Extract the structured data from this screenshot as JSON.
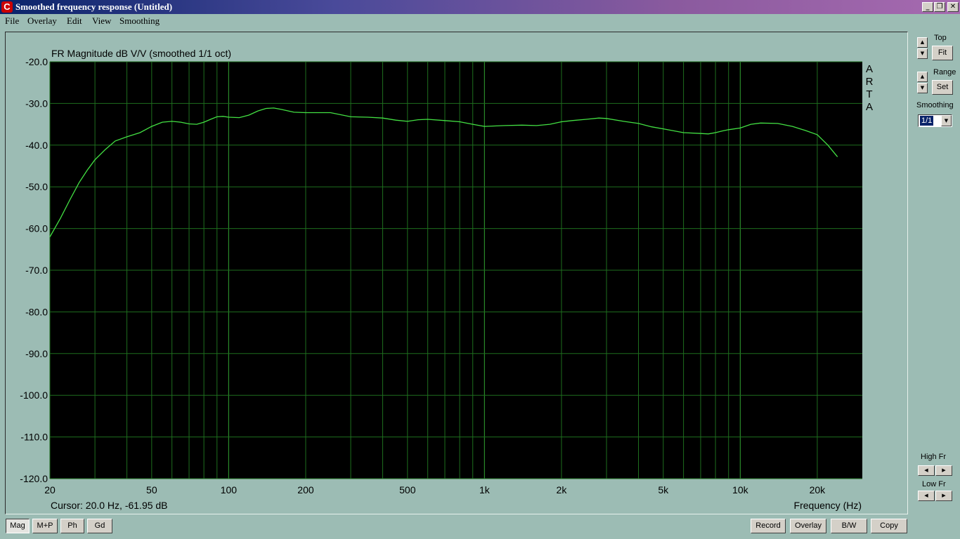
{
  "window": {
    "title": "Smoothed frequency response (Untitled)",
    "app_icon": "arta-c-icon",
    "controls": [
      "minimize-icon",
      "restore-icon",
      "close-icon"
    ]
  },
  "menu": [
    "File",
    "Overlay",
    "Edit",
    "View",
    "Smoothing"
  ],
  "plot": {
    "watermark": "A R T A",
    "cursor_readout": "Cursor: 20.0 Hz, -61.95 dB",
    "background": "#000000",
    "grid_color": "#1e6e1e",
    "trace_color": "#43e043"
  },
  "side_panel": {
    "top_label": "Top",
    "fit_button": "Fit",
    "range_label": "Range",
    "set_button": "Set",
    "smoothing_label": "Smoothing",
    "smoothing_value": "1/1",
    "high_fr_label": "High Fr",
    "low_fr_label": "Low Fr"
  },
  "bottom_left_buttons": [
    "Mag",
    "M+P",
    "Ph",
    "Gd"
  ],
  "active_tab": "Mag",
  "bottom_right_buttons": [
    "Record",
    "Overlay",
    "B/W",
    "Copy"
  ],
  "chart_data": {
    "type": "line",
    "title": "FR Magnitude dB V/V (smoothed 1/1 oct)",
    "xlabel": "Frequency (Hz)",
    "ylabel": "",
    "x_scale": "log",
    "xlim": [
      20,
      30000
    ],
    "ylim": [
      -120,
      -20
    ],
    "grid": true,
    "x_ticks": [
      {
        "value": 20,
        "label": "20"
      },
      {
        "value": 50,
        "label": "50"
      },
      {
        "value": 100,
        "label": "100"
      },
      {
        "value": 200,
        "label": "200"
      },
      {
        "value": 500,
        "label": "500"
      },
      {
        "value": 1000,
        "label": "1k"
      },
      {
        "value": 2000,
        "label": "2k"
      },
      {
        "value": 5000,
        "label": "5k"
      },
      {
        "value": 10000,
        "label": "10k"
      },
      {
        "value": 20000,
        "label": "20k"
      }
    ],
    "y_ticks": [
      {
        "value": -20,
        "label": "-20.0"
      },
      {
        "value": -30,
        "label": "-30.0"
      },
      {
        "value": -40,
        "label": "-40.0"
      },
      {
        "value": -50,
        "label": "-50.0"
      },
      {
        "value": -60,
        "label": "-60.0"
      },
      {
        "value": -70,
        "label": "-70.0"
      },
      {
        "value": -80,
        "label": "-80.0"
      },
      {
        "value": -90,
        "label": "-90.0"
      },
      {
        "value": -100,
        "label": "-100.0"
      },
      {
        "value": -110,
        "label": "-110.0"
      },
      {
        "value": -120,
        "label": "-120.0"
      }
    ],
    "x_grid": [
      20,
      30,
      40,
      50,
      60,
      70,
      80,
      90,
      100,
      200,
      300,
      400,
      500,
      600,
      700,
      800,
      900,
      1000,
      2000,
      3000,
      4000,
      5000,
      6000,
      7000,
      8000,
      9000,
      10000,
      20000
    ],
    "series": [
      {
        "x": [
          20,
          22,
          24,
          26,
          28,
          30,
          33,
          36,
          40,
          45,
          50,
          55,
          60,
          65,
          70,
          75,
          80,
          85,
          90,
          95,
          100,
          110,
          120,
          130,
          140,
          150,
          160,
          180,
          200,
          250,
          300,
          350,
          400,
          450,
          500,
          550,
          600,
          700,
          800,
          900,
          1000,
          1200,
          1400,
          1600,
          1800,
          2000,
          2200,
          2500,
          2800,
          3000,
          3500,
          4000,
          4500,
          5000,
          6000,
          7000,
          7500,
          8000,
          8500,
          9000,
          10000,
          11000,
          12000,
          14000,
          16000,
          18000,
          20000,
          22000,
          24000
        ],
        "y": [
          -62,
          -57.5,
          -53,
          -49,
          -46,
          -43.5,
          -41,
          -39,
          -38,
          -37,
          -35.5,
          -34.5,
          -34.3,
          -34.5,
          -34.9,
          -35,
          -34.5,
          -33.8,
          -33.2,
          -33.1,
          -33.3,
          -33.4,
          -32.8,
          -31.8,
          -31.2,
          -31.1,
          -31.4,
          -32.1,
          -32.2,
          -32.2,
          -33.2,
          -33.3,
          -33.5,
          -34.0,
          -34.3,
          -33.9,
          -33.8,
          -34.1,
          -34.4,
          -35.0,
          -35.5,
          -35.3,
          -35.2,
          -35.3,
          -35.0,
          -34.4,
          -34.1,
          -33.8,
          -33.5,
          -33.6,
          -34.3,
          -34.8,
          -35.6,
          -36.1,
          -37.0,
          -37.2,
          -37.3,
          -37.0,
          -36.6,
          -36.3,
          -35.9,
          -35.0,
          -34.7,
          -34.8,
          -35.5,
          -36.5,
          -37.5,
          -40.0,
          -42.8
        ]
      }
    ]
  }
}
